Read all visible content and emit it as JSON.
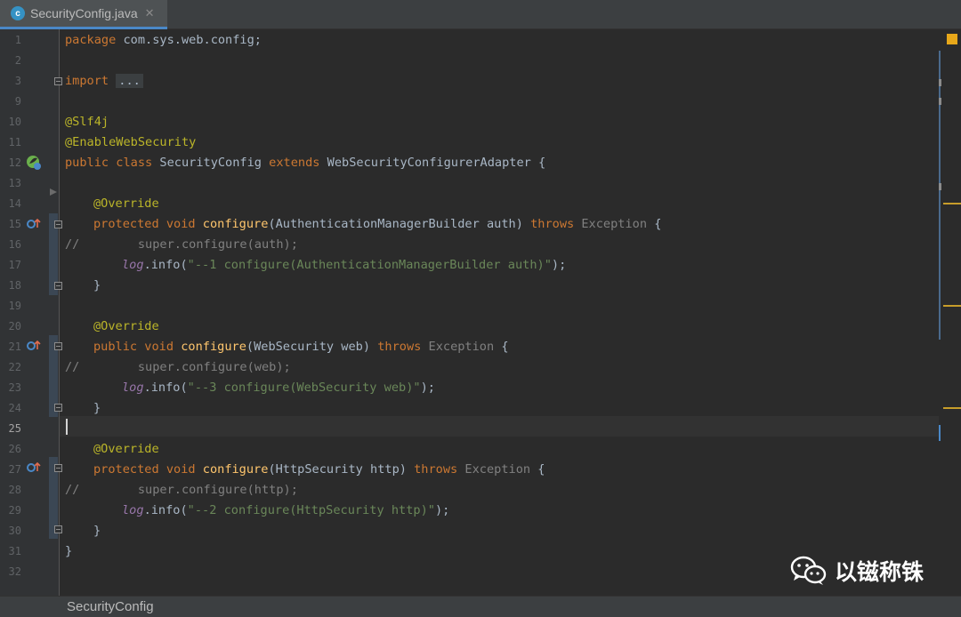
{
  "tab": {
    "filename": "SecurityConfig.java",
    "icon_letter": "c",
    "close_glyph": "✕"
  },
  "breadcrumb": {
    "item": "SecurityConfig"
  },
  "watermark": {
    "text": "以镃称铢"
  },
  "line_numbers": [
    "1",
    "2",
    "3",
    "9",
    "10",
    "11",
    "12",
    "13",
    "14",
    "15",
    "16",
    "17",
    "18",
    "19",
    "20",
    "21",
    "22",
    "23",
    "24",
    "25",
    "26",
    "27",
    "28",
    "29",
    "30",
    "31",
    "32"
  ],
  "code": {
    "l1": [
      "package",
      " com.sys.web.config;"
    ],
    "l3": [
      "import",
      "..."
    ],
    "l10": "@Slf4j",
    "l11": "@EnableWebSecurity",
    "l12": [
      "public class",
      " SecurityConfig ",
      "extends",
      " WebSecurityConfigurerAdapter {"
    ],
    "l14": "@Override",
    "l15": [
      "protected void",
      "configure",
      "(AuthenticationManagerBuilder auth) ",
      "throws",
      "Exception",
      " {"
    ],
    "l16": "//        super.configure(auth);",
    "l17": [
      "log",
      ".info(",
      "\"--1 configure(AuthenticationManagerBuilder auth)\"",
      ");"
    ],
    "l18": "}",
    "l20": "@Override",
    "l21": [
      "public void",
      "configure",
      "(WebSecurity web) ",
      "throws",
      "Exception",
      " {"
    ],
    "l22": "//        super.configure(web);",
    "l23": [
      "log",
      ".info(",
      "\"--3 configure(WebSecurity web)\"",
      ");"
    ],
    "l24": "}",
    "l26": "@Override",
    "l27": [
      "protected void",
      "configure",
      "(HttpSecurity http) ",
      "throws",
      "Exception",
      " {"
    ],
    "l28": "//        super.configure(http);",
    "l29": [
      "log",
      ".info(",
      "\"--2 configure(HttpSecurity http)\"",
      ");"
    ],
    "l30": "}",
    "l31": "}"
  },
  "colors": {
    "keyword": "#cc7832",
    "annotation": "#bbb529",
    "method": "#ffc66d",
    "string": "#6a8759",
    "comment": "#808080",
    "log_field": "#9876aa"
  }
}
